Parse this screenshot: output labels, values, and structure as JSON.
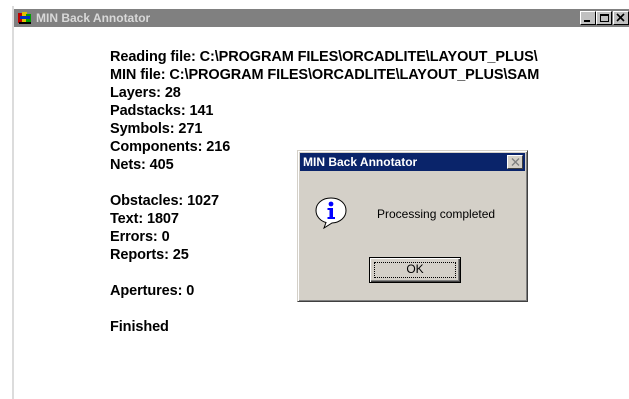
{
  "main_window": {
    "title": "MIN Back Annotator",
    "app_icon": "orcad-layout-app-icon",
    "buttons": {
      "minimize_icon": "minimize-icon",
      "restore_icon": "restore-icon",
      "close_icon": "close-icon"
    }
  },
  "log": {
    "reading_file": "Reading file: C:\\PROGRAM FILES\\ORCADLITE\\LAYOUT_PLUS\\",
    "min_file": "MIN file: C:\\PROGRAM FILES\\ORCADLITE\\LAYOUT_PLUS\\SAM",
    "layers": "Layers: 28",
    "padstacks": "Padstacks: 141",
    "symbols": "Symbols: 271",
    "components": "Components: 216",
    "nets": "Nets: 405",
    "obstacles": "Obstacles: 1027",
    "text": "Text: 1807",
    "errors": "Errors: 0",
    "reports": "Reports: 25",
    "apertures": "Apertures: 0",
    "finished": "Finished"
  },
  "dialog": {
    "title": "MIN Back Annotator",
    "message": "Processing completed",
    "ok_label": "OK",
    "icon": "information-icon"
  },
  "colors": {
    "inactive_titlebar": "#808080",
    "active_titlebar": "#0a246a",
    "dialog_face": "#d4d0c8",
    "info_icon_blue": "#0000ff"
  }
}
